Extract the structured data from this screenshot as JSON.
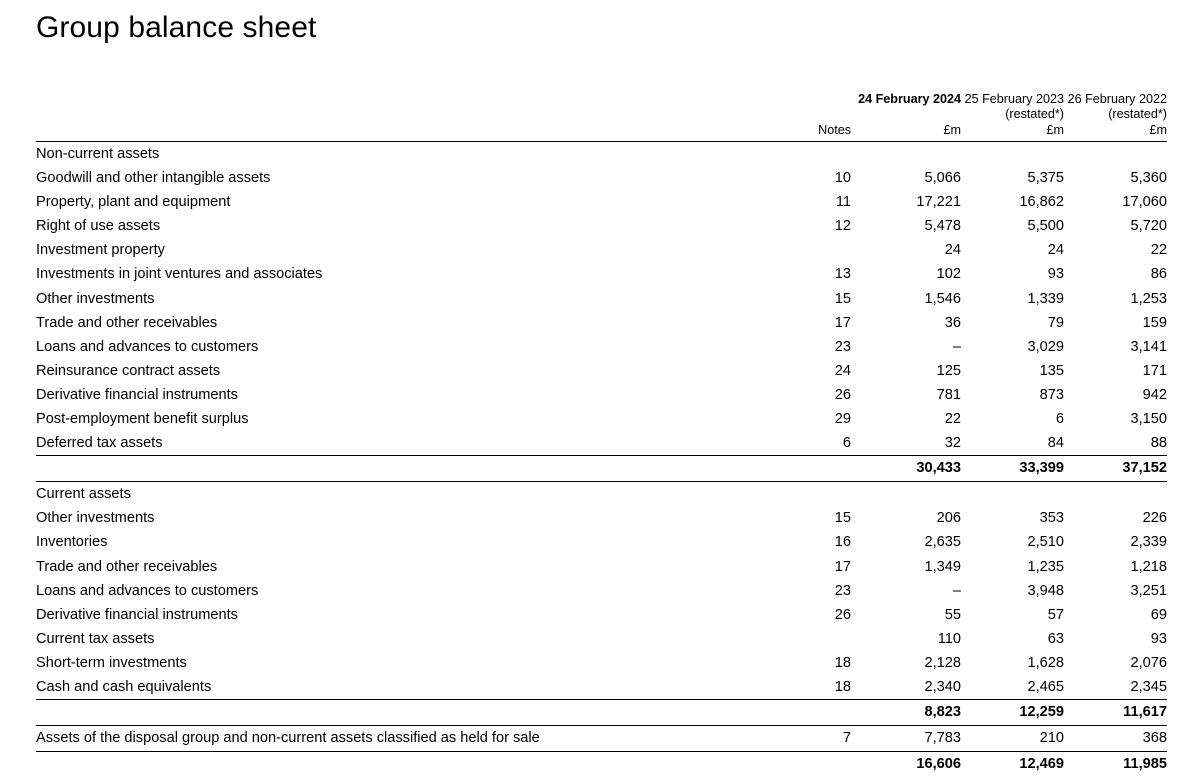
{
  "document": {
    "title": "Group balance sheet"
  },
  "table": {
    "columns": {
      "notes_header": "Notes",
      "col1": {
        "date": "24 February 2024",
        "restated": "",
        "unit": "£m"
      },
      "col2": {
        "date": "25 February 2023",
        "restated": "(restated*)",
        "unit": "£m"
      },
      "col3": {
        "date": "26 February 2022",
        "restated": "(restated*)",
        "unit": "£m"
      }
    },
    "sections": [
      {
        "heading": "Non-current assets",
        "rows": [
          {
            "label": "Goodwill and other intangible assets",
            "notes": "10",
            "v1": "5,066",
            "v2": "5,375",
            "v3": "5,360"
          },
          {
            "label": "Property, plant and equipment",
            "notes": "11",
            "v1": "17,221",
            "v2": "16,862",
            "v3": "17,060"
          },
          {
            "label": "Right of use assets",
            "notes": "12",
            "v1": "5,478",
            "v2": "5,500",
            "v3": "5,720"
          },
          {
            "label": "Investment property",
            "notes": "",
            "v1": "24",
            "v2": "24",
            "v3": "22"
          },
          {
            "label": "Investments in joint ventures and associates",
            "notes": "13",
            "v1": "102",
            "v2": "93",
            "v3": "86"
          },
          {
            "label": "Other investments",
            "notes": "15",
            "v1": "1,546",
            "v2": "1,339",
            "v3": "1,253"
          },
          {
            "label": "Trade and other receivables",
            "notes": "17",
            "v1": "36",
            "v2": "79",
            "v3": "159"
          },
          {
            "label": "Loans and advances to customers",
            "notes": "23",
            "v1": "–",
            "v2": "3,029",
            "v3": "3,141"
          },
          {
            "label": "Reinsurance contract assets",
            "notes": "24",
            "v1": "125",
            "v2": "135",
            "v3": "171"
          },
          {
            "label": "Derivative financial instruments",
            "notes": "26",
            "v1": "781",
            "v2": "873",
            "v3": "942"
          },
          {
            "label": "Post-employment benefit surplus",
            "notes": "29",
            "v1": "22",
            "v2": "6",
            "v3": "3,150"
          },
          {
            "label": "Deferred tax assets",
            "notes": "6",
            "v1": "32",
            "v2": "84",
            "v3": "88"
          }
        ],
        "total": {
          "label": "",
          "notes": "",
          "v1": "30,433",
          "v2": "33,399",
          "v3": "37,152"
        }
      },
      {
        "heading": "Current assets",
        "rows": [
          {
            "label": "Other investments",
            "notes": "15",
            "v1": "206",
            "v2": "353",
            "v3": "226"
          },
          {
            "label": "Inventories",
            "notes": "16",
            "v1": "2,635",
            "v2": "2,510",
            "v3": "2,339"
          },
          {
            "label": "Trade and other receivables",
            "notes": "17",
            "v1": "1,349",
            "v2": "1,235",
            "v3": "1,218"
          },
          {
            "label": "Loans and advances to customers",
            "notes": "23",
            "v1": "–",
            "v2": "3,948",
            "v3": "3,251"
          },
          {
            "label": "Derivative financial instruments",
            "notes": "26",
            "v1": "55",
            "v2": "57",
            "v3": "69"
          },
          {
            "label": "Current tax assets",
            "notes": "",
            "v1": "110",
            "v2": "63",
            "v3": "93"
          },
          {
            "label": "Short-term investments",
            "notes": "18",
            "v1": "2,128",
            "v2": "1,628",
            "v3": "2,076"
          },
          {
            "label": "Cash and cash equivalents",
            "notes": "18",
            "v1": "2,340",
            "v2": "2,465",
            "v3": "2,345"
          }
        ],
        "total": {
          "label": "",
          "notes": "",
          "v1": "8,823",
          "v2": "12,259",
          "v3": "11,617"
        }
      }
    ],
    "held_for_sale": {
      "label": "Assets of the disposal group and non-current assets classified as held for sale",
      "notes": "7",
      "v1": "7,783",
      "v2": "210",
      "v3": "368"
    },
    "grand_total": {
      "label": "",
      "notes": "",
      "v1": "16,606",
      "v2": "12,469",
      "v3": "11,985"
    }
  }
}
